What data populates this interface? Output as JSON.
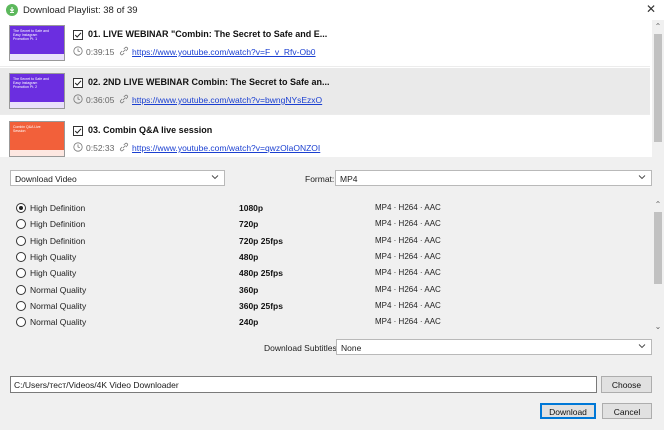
{
  "window": {
    "title": "Download Playlist: 38 of 39",
    "close_icon": "close-icon"
  },
  "playlist": [
    {
      "thumb_text": "The Secret to Safe and Easy Instagram Promotion Pt. 1",
      "thumb_color": "#6b2ee0",
      "checked": true,
      "title": "01. LIVE WEBINAR \"Combin: The Secret to Safe and E...",
      "duration": "0:39:15",
      "url": "https://www.youtube.com/watch?v=F_v_Rfv-Ob0",
      "selected": false
    },
    {
      "thumb_text": "The Secret to Safe and Easy Instagram Promotion Pt. 2",
      "thumb_color": "#6b2ee0",
      "checked": true,
      "title": "02. 2ND LIVE WEBINAR Combin: The Secret to Safe an...",
      "duration": "0:36:05",
      "url": "https://www.youtube.com/watch?v=bwngNYsEzxO",
      "selected": true
    },
    {
      "thumb_text": "Combin Q&A Live Session",
      "thumb_color": "#f2603a",
      "checked": true,
      "title": "03. Combin Q&A live session",
      "duration": "0:52:33",
      "url": "https://www.youtube.com/watch?v=qwzOlaONZOI",
      "selected": false
    }
  ],
  "options": {
    "download_type": "Download Video",
    "format_label": "Format:",
    "format_value": "MP4",
    "subtitles_label": "Download Subtitles:",
    "subtitles_value": "None"
  },
  "qualities": [
    {
      "name": "High Definition",
      "res": "1080p",
      "fmt": "MP4 · H264 · AAC",
      "selected": true
    },
    {
      "name": "High Definition",
      "res": "720p",
      "fmt": "MP4 · H264 · AAC",
      "selected": false
    },
    {
      "name": "High Definition",
      "res": "720p 25fps",
      "fmt": "MP4 · H264 · AAC",
      "selected": false
    },
    {
      "name": "High Quality",
      "res": "480p",
      "fmt": "MP4 · H264 · AAC",
      "selected": false
    },
    {
      "name": "High Quality",
      "res": "480p 25fps",
      "fmt": "MP4 · H264 · AAC",
      "selected": false
    },
    {
      "name": "Normal Quality",
      "res": "360p",
      "fmt": "MP4 · H264 · AAC",
      "selected": false
    },
    {
      "name": "Normal Quality",
      "res": "360p 25fps",
      "fmt": "MP4 · H264 · AAC",
      "selected": false
    },
    {
      "name": "Normal Quality",
      "res": "240p",
      "fmt": "MP4 · H264 · AAC",
      "selected": false
    }
  ],
  "path": {
    "value": "C:/Users/тест/Videos/4K Video Downloader",
    "choose_label": "Choose"
  },
  "footer": {
    "download_label": "Download",
    "cancel_label": "Cancel"
  },
  "colors": {
    "accent_green": "#5cb85c",
    "link_blue": "#1a3fd1",
    "primary_border": "#0078d7"
  }
}
